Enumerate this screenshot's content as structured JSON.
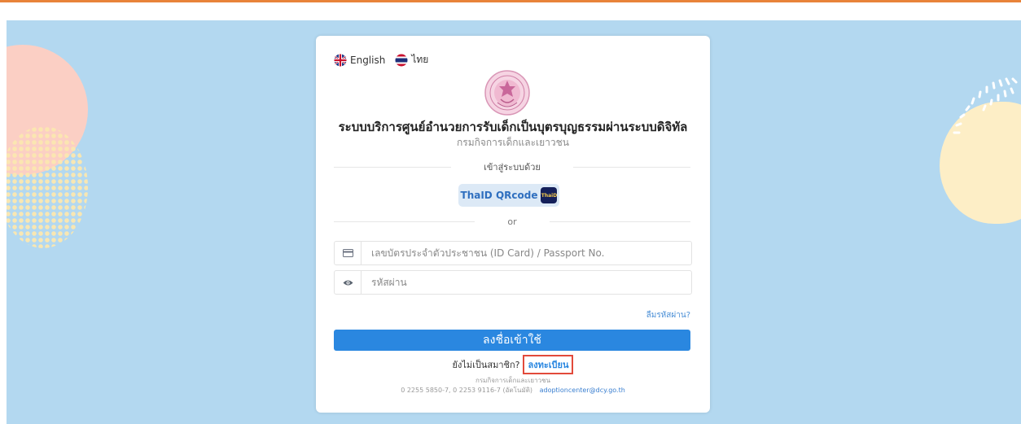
{
  "language": {
    "english_label": "English",
    "thai_label": "ไทย"
  },
  "header": {
    "title": "ระบบบริการศูนย์อำนวยการรับเด็กเป็นบุตรบุญธรรมผ่านระบบดิจิทัล",
    "subtitle": "กรมกิจการเด็กและเยาวชน"
  },
  "login": {
    "login_with_label": "เข้าสู่ระบบด้วย",
    "thaid_label": "ThaID QRcode",
    "thaid_badge": "ThaiD",
    "or_label": "or",
    "id_placeholder": "เลขบัตรประจำตัวประชาชน (ID Card) / Passport No.",
    "password_placeholder": "รหัสผ่าน",
    "forgot_label": "ลืมรหัสผ่าน?",
    "submit_label": "ลงชื่อเข้าใช้",
    "not_member_label": "ยังไม่เป็นสมาชิก?",
    "register_label": "ลงทะเบียน"
  },
  "footer": {
    "org": "กรมกิจการเด็กและเยาวชน",
    "phones": "0 2255 5850-7, 0 2253 9116-7 (อัตโนมัติ)",
    "email": "adoptioncenter@dcy.go.th"
  },
  "colors": {
    "accent": "#2a87e0",
    "top_bar": "#e8833a",
    "background": "#b3d8f0",
    "highlight_border": "#e24a3b"
  },
  "icons": {
    "english": "uk-flag-icon",
    "thai": "thai-flag-icon",
    "seal": "government-seal-icon",
    "id_field": "id-card-icon",
    "password_field": "eye-icon"
  }
}
